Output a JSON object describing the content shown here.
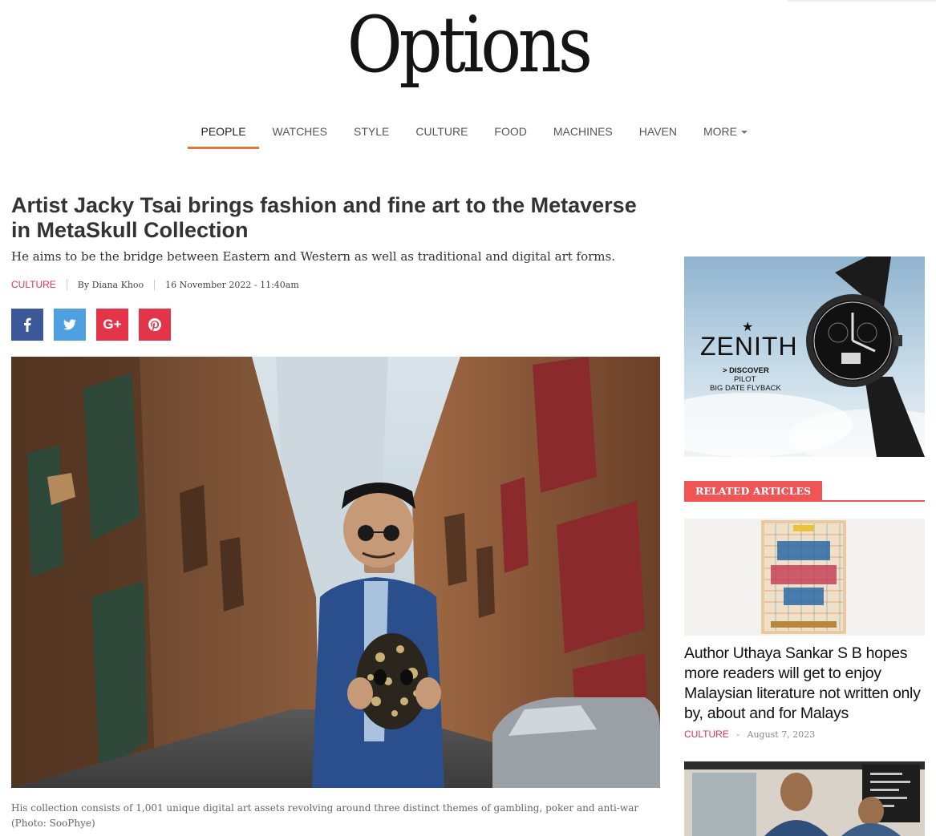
{
  "site": {
    "logo": "Options"
  },
  "nav": {
    "items": [
      "PEOPLE",
      "WATCHES",
      "STYLE",
      "CULTURE",
      "FOOD",
      "MACHINES",
      "HAVEN"
    ],
    "more_label": "MORE",
    "active": "PEOPLE",
    "accent_color": "#e8733a"
  },
  "article": {
    "title": "Artist Jacky Tsai brings fashion and fine art to the Metaverse in MetaSkull Collection",
    "subtitle": "He aims to be the bridge between Eastern and Western as well as traditional and digital art forms.",
    "category": "CULTURE",
    "author": "By Diana Khoo",
    "date": "16 November 2022 - 11:40am",
    "caption": "His collection consists of 1,001 unique digital art assets revolving around three distinct themes of gambling, poker and anti-war (Photo: SooPhye)",
    "category_color": "#e0334d"
  },
  "share": {
    "icons": [
      "facebook-icon",
      "twitter-icon",
      "google-plus-icon",
      "pinterest-icon"
    ],
    "google_plus_label": "G+",
    "colors": {
      "facebook": "#3b5998",
      "twitter": "#4fa0e0",
      "google_plus": "#e3344a",
      "pinterest": "#e3344a"
    }
  },
  "ad": {
    "brand": "ZENITH",
    "line1": "> DISCOVER",
    "line2": "PILOT",
    "line3": "BIG DATE FLYBACK"
  },
  "related": {
    "heading": "RELATED ARTICLES",
    "heading_color": "#ef5555",
    "items": [
      {
        "title": "Author Uthaya Sankar S B hopes more readers will get to enjoy Malaysian literature not written only by, about and for Malays",
        "category": "CULTURE",
        "separator": "-",
        "date": "August 7, 2023"
      }
    ]
  }
}
